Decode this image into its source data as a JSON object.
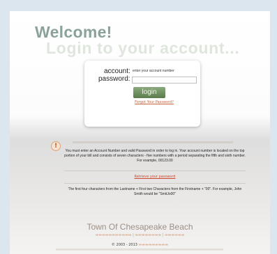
{
  "page": {
    "welcome": "Welcome!",
    "subtitle": "Login to your account..."
  },
  "login_form": {
    "account_label": "account:",
    "account_placeholder": "enter your account number",
    "password_label": "password:",
    "password_value": "",
    "login_button": "login",
    "forgot_password": "Forgot Your Password?"
  },
  "notice": {
    "icon": "warning-icon",
    "instructions": "You must enter an Account Number and valid Password in order to log in. Your account number is located on the top portion of your bill and consists of seven characters - five numbers with a period separating the fifth and sixth number. For example, 00123.00",
    "retrieve_link": "Retrieve your password",
    "password_hint": "The first four characters from the Lastname + First two Characters from the Firstname + \"00\". For example, John Smith would be \"SmitJo00\""
  },
  "footer": {
    "town_name": "Town Of Chesapeake Beach",
    "copyright_prefix": "© 2003 - 2013"
  },
  "colors": {
    "background": "#dbe6ef",
    "welcome": "#8ba29b",
    "login_button": "#5b7c4c",
    "link": "#c8623a"
  }
}
